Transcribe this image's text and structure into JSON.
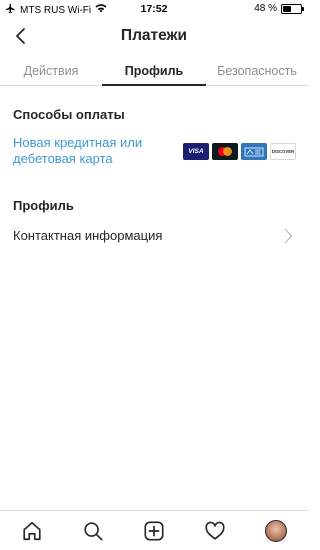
{
  "status_bar": {
    "carrier": "MTS RUS Wi-Fi",
    "time": "17:52",
    "battery_percent_text": "48 %",
    "battery_level": 0.48
  },
  "nav": {
    "title": "Платежи",
    "back_icon": "chevron-left-icon"
  },
  "tabs": [
    {
      "label": "Действия",
      "active": false
    },
    {
      "label": "Профиль",
      "active": true
    },
    {
      "label": "Безопасность",
      "active": false
    }
  ],
  "payment_methods": {
    "title": "Способы оплаты",
    "add_card_label": "Новая кредитная или дебетовая карта",
    "cards": [
      {
        "name": "visa-icon",
        "text": "VISA"
      },
      {
        "name": "mastercard-icon",
        "text": ""
      },
      {
        "name": "amex-icon",
        "text": "AMERICAN EXPRESS"
      },
      {
        "name": "discover-icon",
        "text": "DISCOVER"
      }
    ]
  },
  "profile": {
    "title": "Профиль",
    "contact_info_label": "Контактная информация"
  },
  "bottom_bar": {
    "items": [
      "home-icon",
      "search-icon",
      "new-post-icon",
      "heart-icon",
      "profile-avatar"
    ]
  },
  "colors": {
    "link": "#3d9ad1",
    "text": "#262626",
    "muted": "#8e8e8e",
    "divider": "#dbdbdb"
  }
}
